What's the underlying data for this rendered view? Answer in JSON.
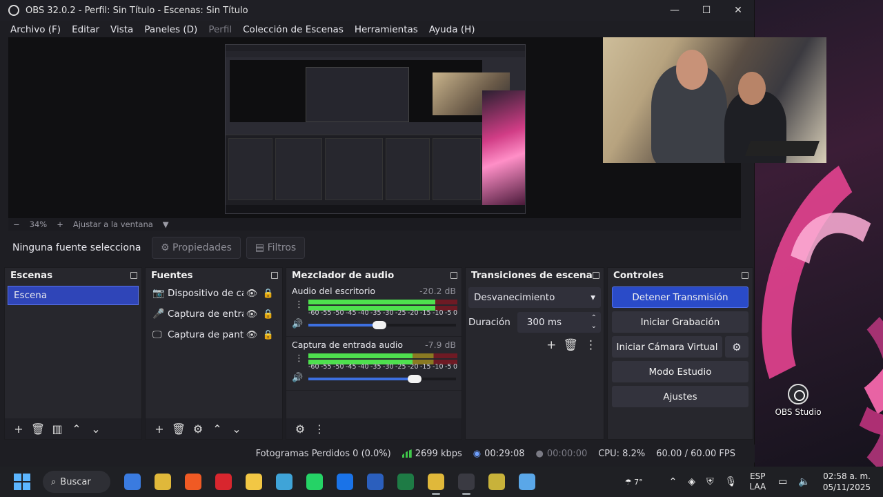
{
  "window": {
    "title": "OBS 32.0.2 - Perfil: Sin Título - Escenas: Sin Título",
    "min": "—",
    "max": "☐",
    "close": "✕"
  },
  "menu": [
    {
      "label": "Archivo (F)"
    },
    {
      "label": "Editar"
    },
    {
      "label": "Vista"
    },
    {
      "label": "Paneles (D)"
    },
    {
      "label": "Perfil"
    },
    {
      "label": "Colección de Escenas"
    },
    {
      "label": "Herramientas"
    },
    {
      "label": "Ayuda (H)"
    }
  ],
  "zoom": {
    "minus": "−",
    "value": "34%",
    "plus": "+",
    "fit": "Ajustar a la ventana",
    "dropdown": "▼"
  },
  "source_bar": {
    "none_selected": "Ninguna fuente selecciona",
    "properties": "Propiedades",
    "filters": "Filtros"
  },
  "scenes": {
    "title": "Escenas",
    "items": [
      "Escena"
    ]
  },
  "sources": {
    "title": "Fuentes",
    "items": [
      {
        "label": "Dispositivo de cap",
        "icon": "camera-icon",
        "glyph": "📷"
      },
      {
        "label": "Captura de entrac",
        "icon": "microphone-icon",
        "glyph": "🎤"
      },
      {
        "label": "Captura de pantal",
        "icon": "monitor-icon",
        "glyph": "🖵"
      }
    ]
  },
  "mixer": {
    "title": "Mezclador de audio",
    "channels": [
      {
        "name": "Audio del escritorio",
        "db": "-20.2 dB",
        "level": 0.85,
        "volume": 0.48
      },
      {
        "name": "Captura de entrada audio",
        "db": "-7.9 dB",
        "level": 0.7,
        "volume": 0.72
      }
    ],
    "scale": [
      "-60",
      "-55",
      "-50",
      "-45",
      "-40",
      "-35",
      "-30",
      "-25",
      "-20",
      "-15",
      "-10",
      "-5",
      "0"
    ]
  },
  "transitions": {
    "title": "Transiciones de escena",
    "selected": "Desvanecimiento",
    "duration_label": "Duración",
    "duration_value": "300 ms"
  },
  "controls": {
    "title": "Controles",
    "stop_stream": "Detener Transmisión",
    "start_recording": "Iniciar Grabación",
    "start_virtual_cam": "Iniciar Cámara Virtual",
    "studio_mode": "Modo Estudio",
    "settings": "Ajustes"
  },
  "status": {
    "dropped": "Fotogramas Perdidos 0 (0.0%)",
    "bitrate": "2699 kbps",
    "stream_time": "00:29:08",
    "rec_time": "00:00:00",
    "cpu": "CPU: 8.2%",
    "fps": "60.00 / 60.00 FPS"
  },
  "desktop": {
    "obs_icon_label": "OBS Studio"
  },
  "taskbar": {
    "search": "Buscar",
    "weather_temp": "7°",
    "lang_1": "ESP",
    "lang_2": "LAA",
    "time": "02:58 a. m.",
    "date": "05/11/2025",
    "apps": [
      {
        "name": "microsoft-store-icon",
        "color": "#3a7be0"
      },
      {
        "name": "chrome-icon",
        "color": "#e0b83a"
      },
      {
        "name": "brave-icon",
        "color": "#f05a24"
      },
      {
        "name": "acrobat-icon",
        "color": "#d8262e"
      },
      {
        "name": "file-explorer-icon",
        "color": "#f2c744"
      },
      {
        "name": "app-icon",
        "color": "#3fa4d8"
      },
      {
        "name": "whatsapp-icon",
        "color": "#25d366"
      },
      {
        "name": "teamviewer-icon",
        "color": "#1a73e8"
      },
      {
        "name": "word-icon",
        "color": "#2b5fbd"
      },
      {
        "name": "excel-icon",
        "color": "#1e7b45"
      },
      {
        "name": "chrome-icon-2",
        "color": "#e0b83a"
      },
      {
        "name": "obs-icon",
        "color": "#3a3a42"
      },
      {
        "name": "pes-icon",
        "color": "#c8b23a"
      },
      {
        "name": "photos-icon",
        "color": "#5aa7e8"
      }
    ]
  }
}
